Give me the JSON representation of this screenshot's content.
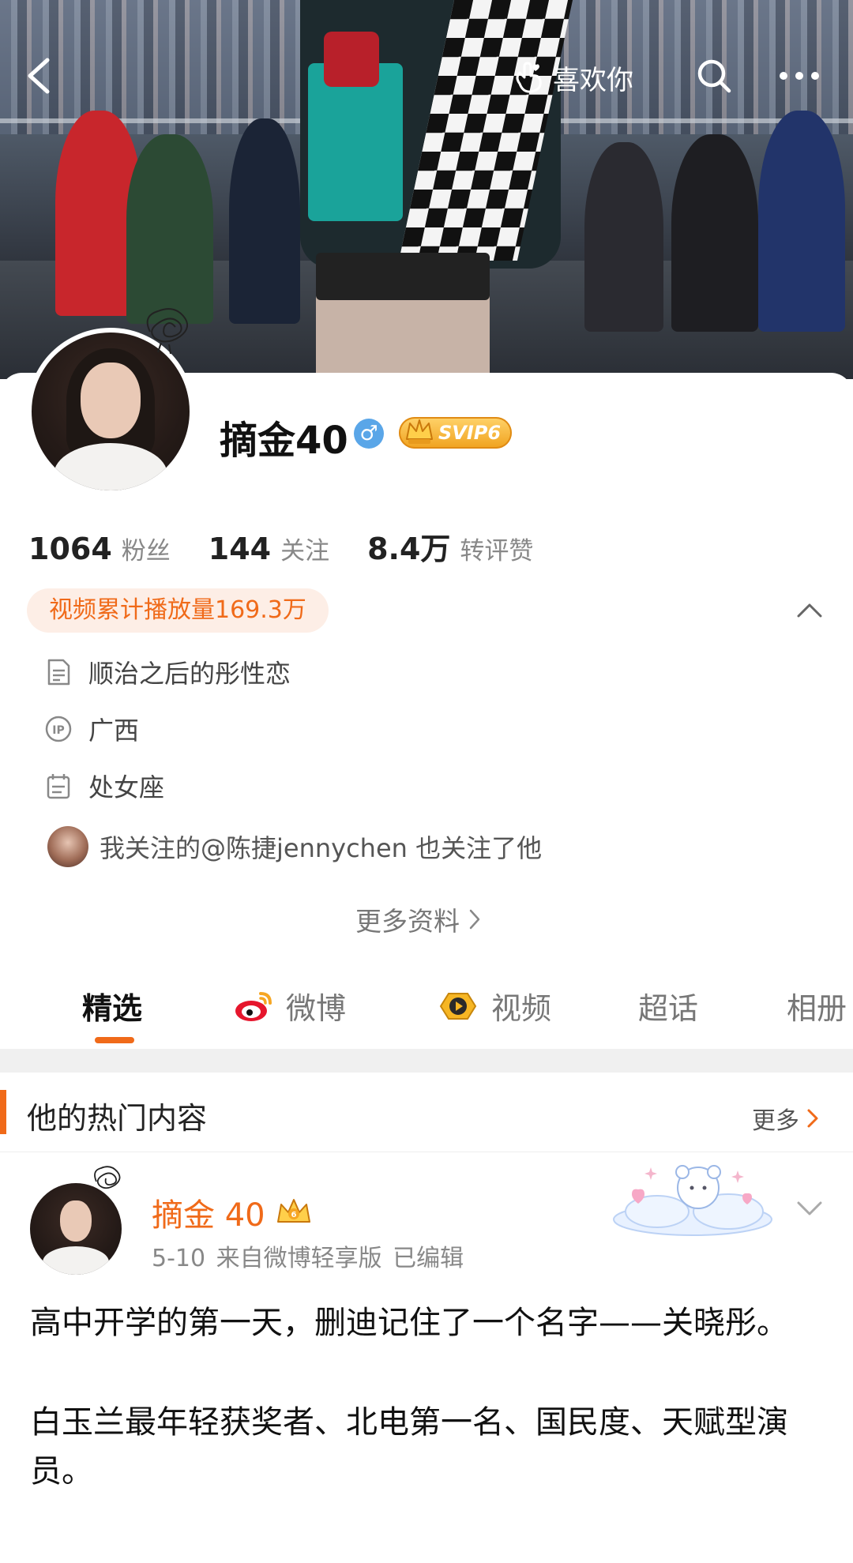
{
  "header": {
    "like_label": "喜欢你"
  },
  "profile": {
    "name": "摘金40",
    "gender_symbol": "♂",
    "vip_badge": "SVIP6",
    "stats": [
      {
        "value": "1064",
        "label": "粉丝"
      },
      {
        "value": "144",
        "label": "关注"
      },
      {
        "value": "8.4万",
        "label": "转评赞"
      }
    ],
    "video_play_count": "视频累计播放量169.3万",
    "bio": "顺治之后的彤性恋",
    "ip_location": "广西",
    "zodiac": "处女座",
    "mutual_follow": "我关注的@陈捷jennychen 也关注了他",
    "more_info": "更多资料"
  },
  "tabs": [
    {
      "label": "精选"
    },
    {
      "label": "微博"
    },
    {
      "label": "视频"
    },
    {
      "label": "超话"
    },
    {
      "label": "相册"
    }
  ],
  "hot_section": {
    "title": "他的热门内容",
    "more_label": "更多"
  },
  "post": {
    "author": "摘金 40",
    "meta": "5-10  来自微博轻享版  已编辑",
    "paragraphs": [
      "高中开学的第一天，删迪记住了一个名字——关晓彤。",
      "白玉兰最年轻获奖者、北电第一名、国民度、天赋型演员。"
    ]
  },
  "colors": {
    "accent": "#f06a19",
    "pill_bg": "#fdeee6",
    "verify_blue": "#5aa6e8"
  }
}
